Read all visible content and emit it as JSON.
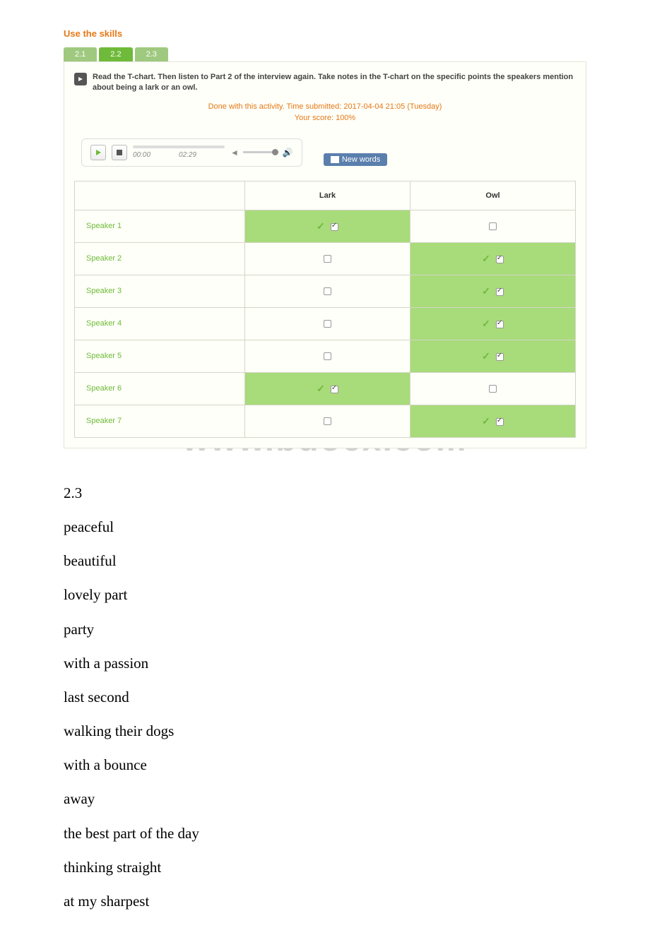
{
  "section_title": "Use the skills",
  "tabs": [
    {
      "label": "2.1",
      "active": false
    },
    {
      "label": "2.2",
      "active": true
    },
    {
      "label": "2.3",
      "active": false
    }
  ],
  "instruction": "Read the T-chart. Then listen to Part 2 of the interview again. Take notes in the T-chart on the specific points the speakers mention about being a lark or an owl.",
  "status_line1": "Done with this activity. Time submitted: 2017-04-04 21:05 (Tuesday)",
  "status_line2": "Your score: 100%",
  "audio": {
    "current": "00:00",
    "duration": "02:29"
  },
  "new_words_label": "New words",
  "table": {
    "headers": [
      "",
      "Lark",
      "Owl"
    ],
    "rows": [
      {
        "speaker": "Speaker 1",
        "lark": true,
        "owl": false
      },
      {
        "speaker": "Speaker 2",
        "lark": false,
        "owl": true
      },
      {
        "speaker": "Speaker 3",
        "lark": false,
        "owl": true
      },
      {
        "speaker": "Speaker 4",
        "lark": false,
        "owl": true
      },
      {
        "speaker": "Speaker 5",
        "lark": false,
        "owl": true
      },
      {
        "speaker": "Speaker 6",
        "lark": true,
        "owl": false
      },
      {
        "speaker": "Speaker 7",
        "lark": false,
        "owl": true
      }
    ]
  },
  "watermark": "www.bdocx.com",
  "text_section": {
    "heading": "2.3",
    "items": [
      "peaceful",
      "beautiful",
      "lovely part",
      "party",
      "with a passion",
      "last second",
      "walking their dogs",
      "with a bounce",
      "away",
      "the best part of the day",
      "thinking straight",
      "at my sharpest"
    ]
  }
}
